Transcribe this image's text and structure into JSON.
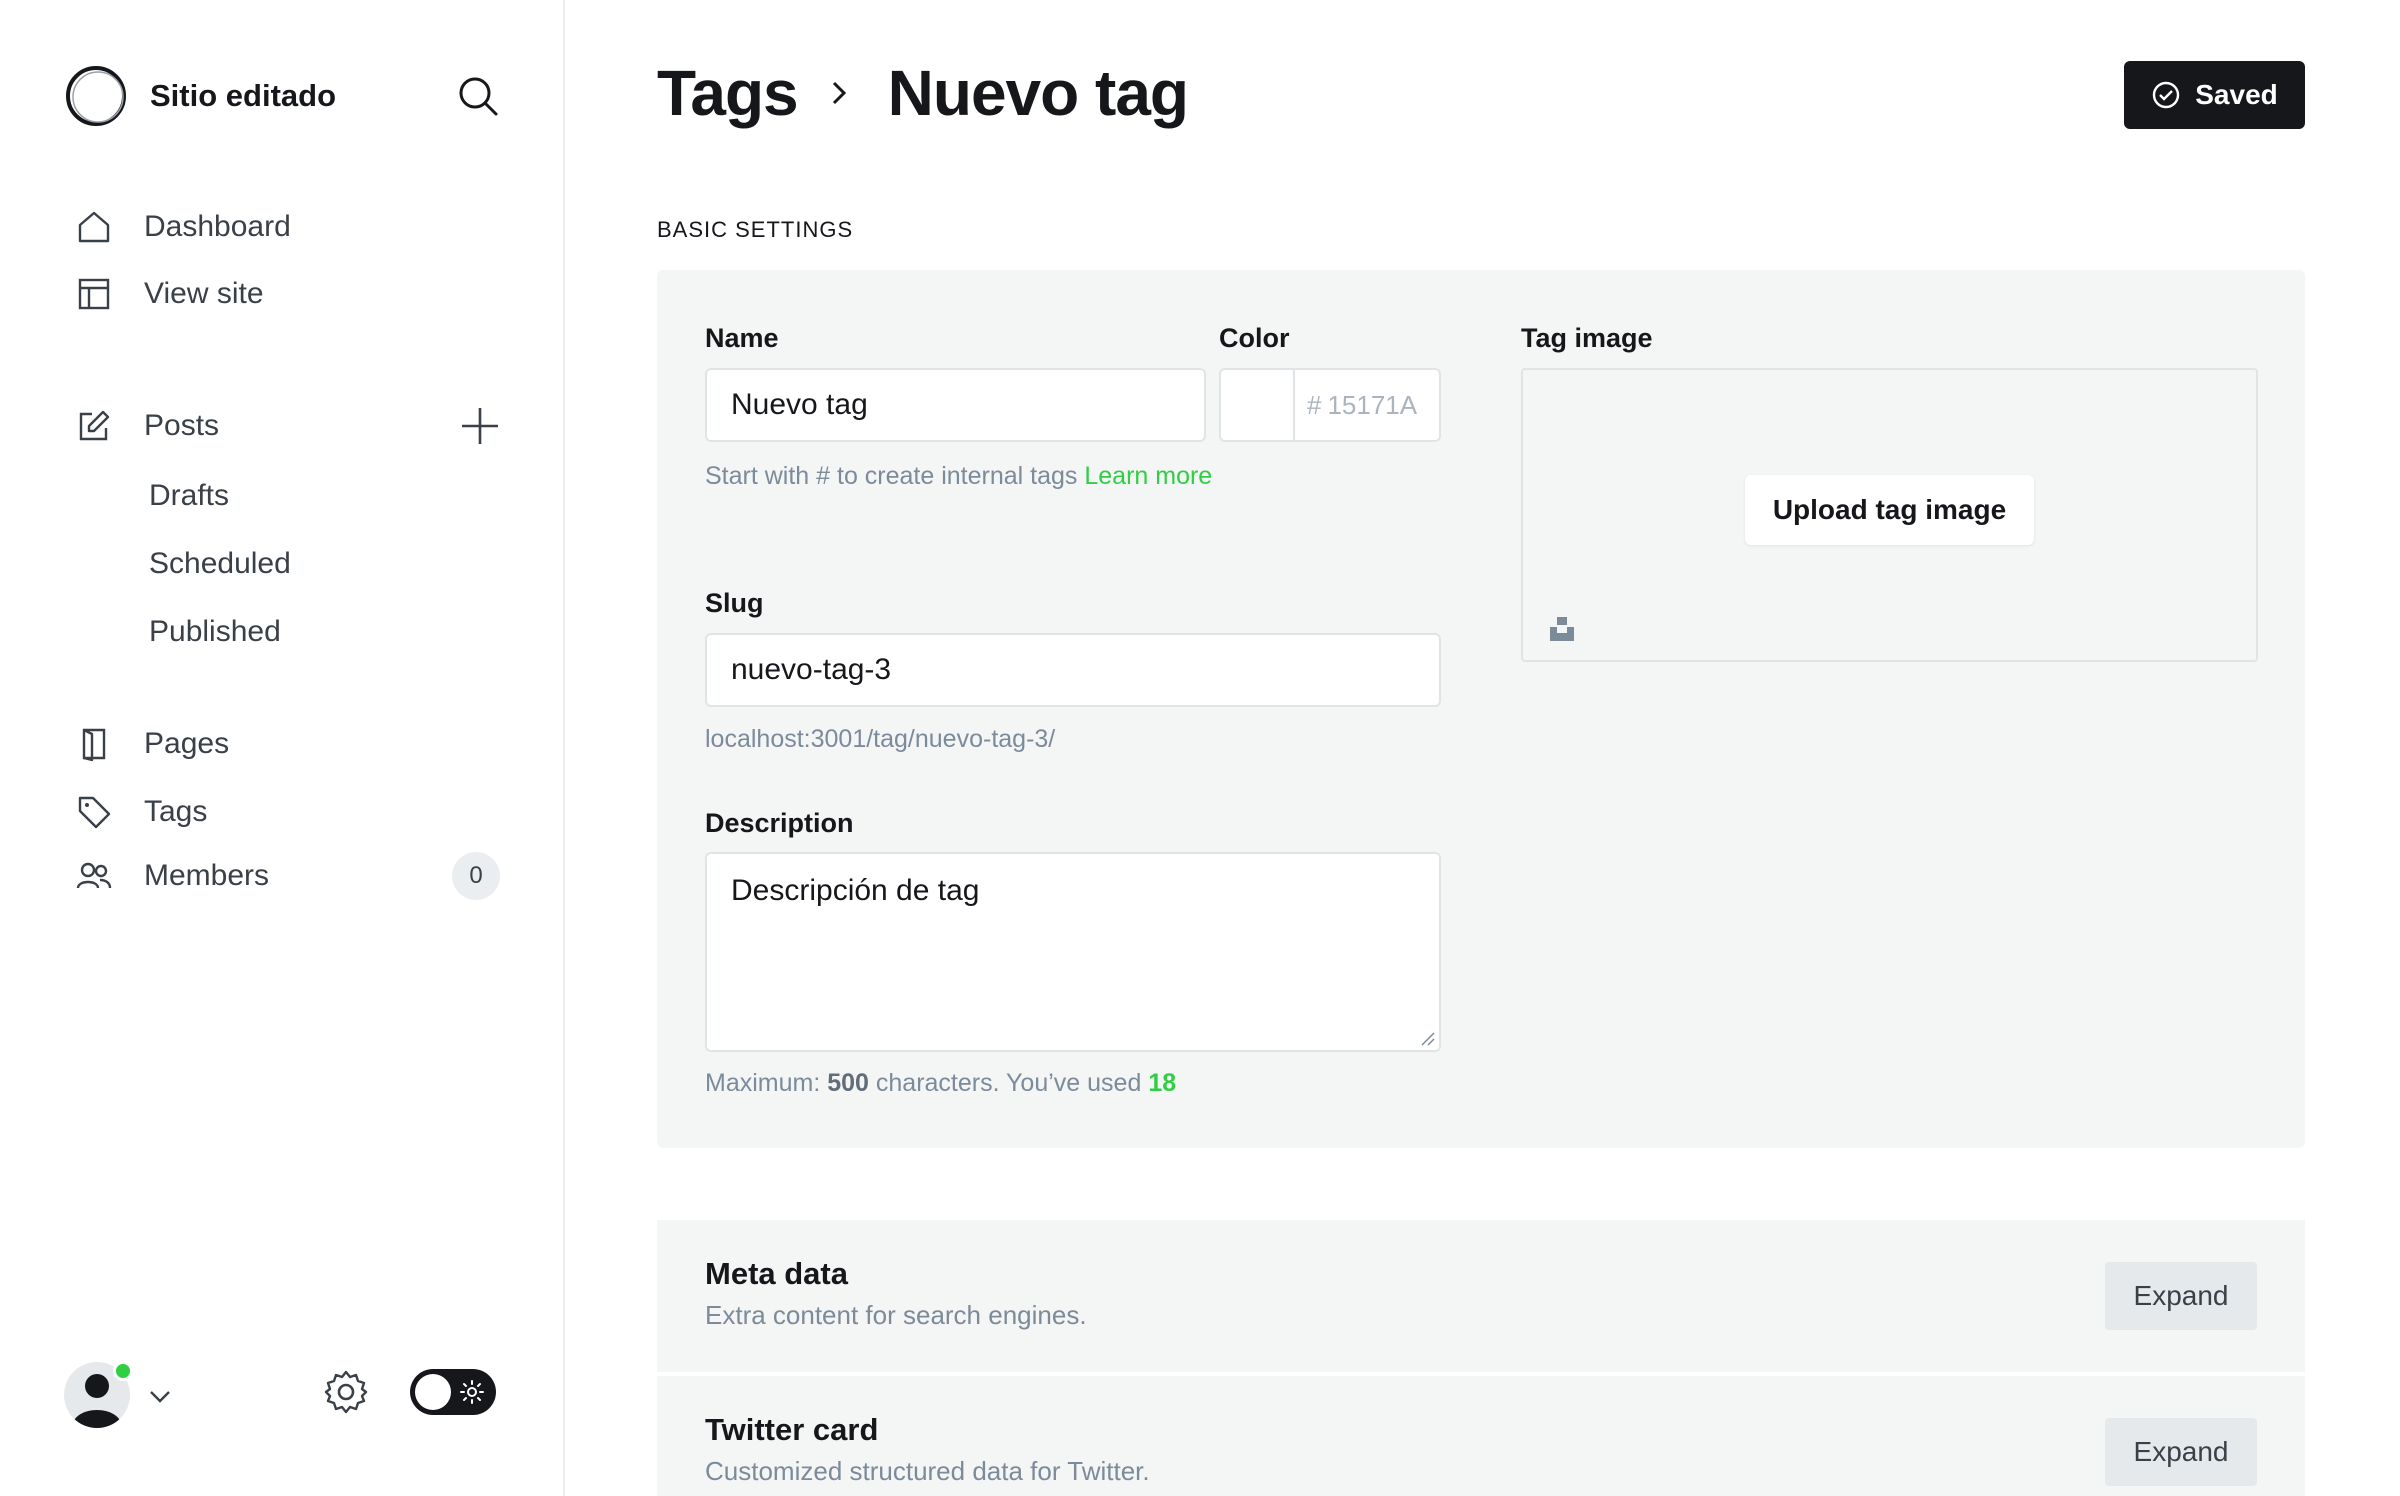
{
  "sidebar": {
    "site_name": "Sitio editado",
    "nav": {
      "dashboard": "Dashboard",
      "view_site": "View site",
      "posts": "Posts",
      "drafts": "Drafts",
      "scheduled": "Scheduled",
      "published": "Published",
      "pages": "Pages",
      "tags": "Tags",
      "members": "Members",
      "members_count": "0"
    }
  },
  "header": {
    "breadcrumb_parent": "Tags",
    "title": "Nuevo tag",
    "save_status": "Saved"
  },
  "basic_settings": {
    "section_label": "BASIC SETTINGS",
    "name_label": "Name",
    "name_value": "Nuevo tag",
    "name_hint": "Start with # to create internal tags ",
    "name_hint_link": "Learn more",
    "color_label": "Color",
    "color_hash": "#",
    "color_placeholder": "15171A",
    "slug_label": "Slug",
    "slug_value": "nuevo-tag-3",
    "slug_url": "localhost:3001/tag/nuevo-tag-3/",
    "description_label": "Description",
    "description_value": "Descripción de tag",
    "counter_prefix": "Maximum: ",
    "counter_max": "500",
    "counter_middle": " characters. You’ve used ",
    "counter_used": "18",
    "tag_image_label": "Tag image",
    "upload_button": "Upload tag image"
  },
  "meta_sections": [
    {
      "title": "Meta data",
      "subtitle": "Extra content for search engines.",
      "button": "Expand"
    },
    {
      "title": "Twitter card",
      "subtitle": "Customized structured data for Twitter.",
      "button": "Expand"
    }
  ],
  "colors": {
    "accent": "#30cf43",
    "dark": "#15171a",
    "panel": "#f4f5f5"
  },
  "icons": [
    "ghost-logo-icon",
    "search-icon",
    "home-icon",
    "layout-icon",
    "edit-icon",
    "plus-icon",
    "page-icon",
    "tag-icon",
    "members-icon",
    "user-icon",
    "chevron-down-icon",
    "gear-icon",
    "sun-icon",
    "check-circle-icon",
    "chevron-right-icon",
    "unsplash-icon"
  ]
}
